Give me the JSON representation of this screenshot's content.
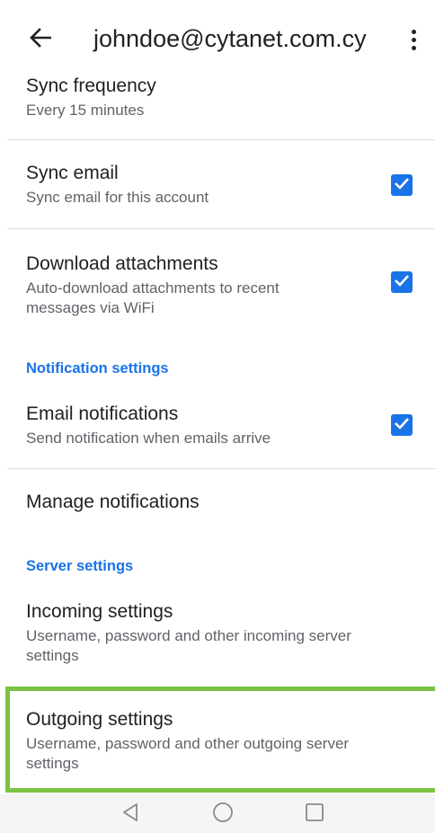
{
  "header": {
    "title": "johndoe@cytanet.com.cy",
    "back_icon": "arrow-back-icon",
    "more_icon": "more-vert-icon"
  },
  "settings": {
    "sync_frequency": {
      "title": "Sync frequency",
      "subtitle": "Every 15 minutes"
    },
    "sync_email": {
      "title": "Sync email",
      "subtitle": "Sync email for this account",
      "checked": true
    },
    "download_attachments": {
      "title": "Download attachments",
      "subtitle": "Auto-download attachments to recent messages via WiFi",
      "checked": true
    },
    "notification_header": "Notification settings",
    "email_notifications": {
      "title": "Email notifications",
      "subtitle": "Send notification when emails arrive",
      "checked": true
    },
    "manage_notifications": {
      "title": "Manage notifications"
    },
    "server_header": "Server settings",
    "incoming": {
      "title": "Incoming settings",
      "subtitle": "Username, password and other incoming server settings"
    },
    "outgoing": {
      "title": "Outgoing settings",
      "subtitle": "Username, password and other outgoing server settings"
    }
  },
  "navigation": {
    "back_icon": "nav-back-triangle-icon",
    "home_icon": "nav-home-circle-icon",
    "recents_icon": "nav-recents-square-icon"
  },
  "colors": {
    "accent": "#1a73e8",
    "highlight": "#7cc243",
    "text_primary": "#202124",
    "text_secondary": "#5f6368"
  }
}
